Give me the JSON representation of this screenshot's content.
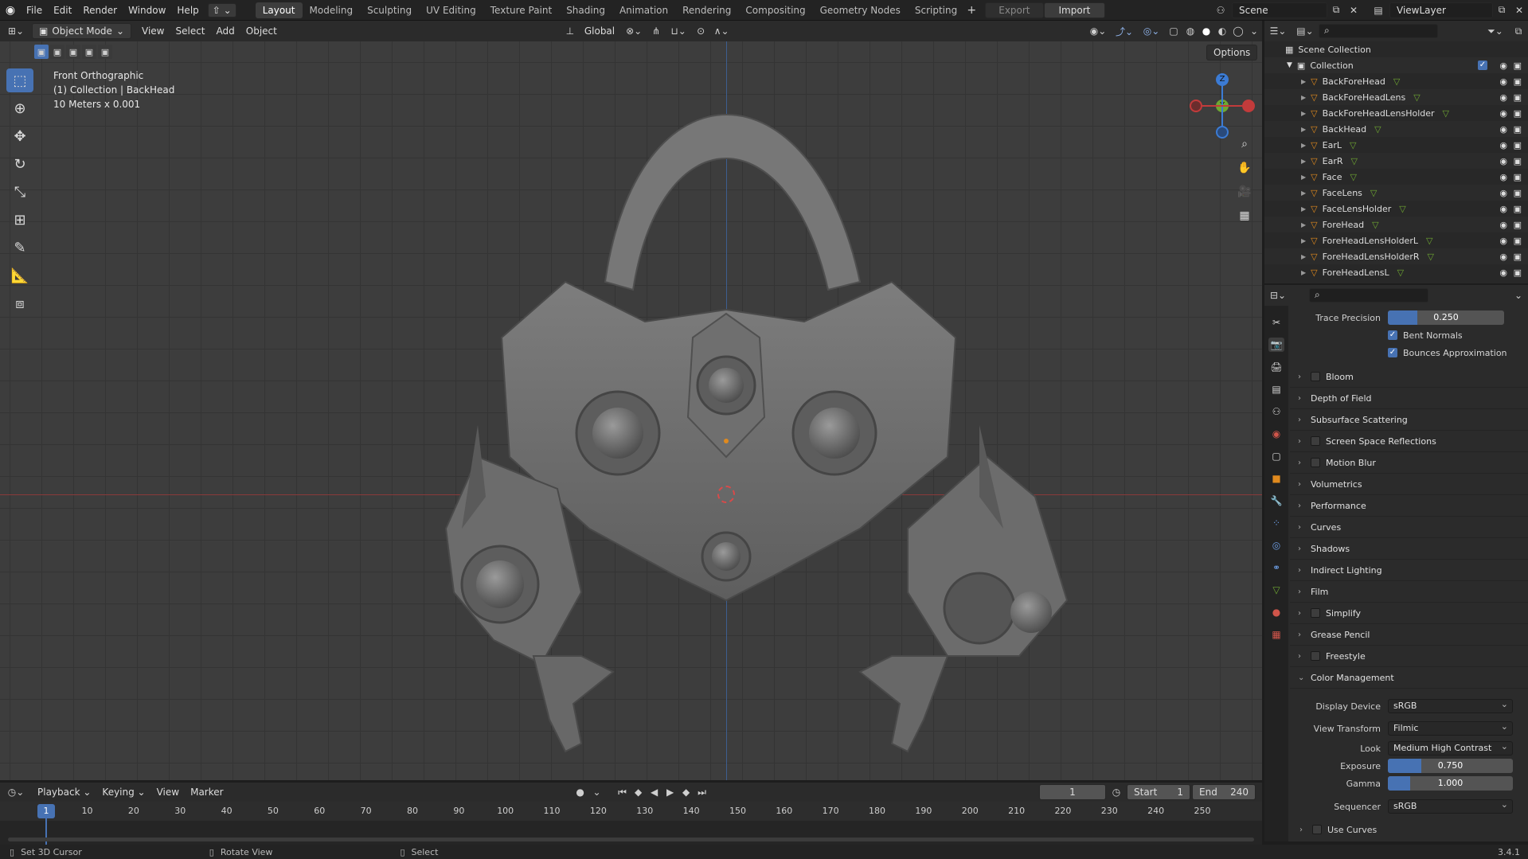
{
  "topbar": {
    "menus": [
      "File",
      "Edit",
      "Render",
      "Window",
      "Help"
    ],
    "workspaces": [
      "Layout",
      "Modeling",
      "Sculpting",
      "UV Editing",
      "Texture Paint",
      "Shading",
      "Animation",
      "Rendering",
      "Compositing",
      "Geometry Nodes",
      "Scripting"
    ],
    "active_workspace": "Layout",
    "export_label": "Export",
    "import_label": "Import",
    "scene_label": "Scene",
    "viewlayer_label": "ViewLayer"
  },
  "viewport_header": {
    "mode": "Object Mode",
    "menus": [
      "View",
      "Select",
      "Add",
      "Object"
    ],
    "orientation": "Global",
    "options_label": "Options"
  },
  "viewport": {
    "view_name": "Front Orthographic",
    "collection_info": "(1) Collection | BackHead",
    "scale_info": "10 Meters x 0.001",
    "axis_z": "Z",
    "axis_y": "Y"
  },
  "outliner": {
    "root": "Scene Collection",
    "collection": "Collection",
    "items": [
      "BackForeHead",
      "BackForeHeadLens",
      "BackForeHeadLensHolder",
      "BackHead",
      "EarL",
      "EarR",
      "Face",
      "FaceLens",
      "FaceLensHolder",
      "ForeHead",
      "ForeHeadLensHolderL",
      "ForeHeadLensHolderR",
      "ForeHeadLensL"
    ],
    "selected": "BackHead"
  },
  "properties": {
    "trace_precision": {
      "label": "Trace Precision",
      "value": "0.250",
      "fraction": 0.25
    },
    "bent_normals": "Bent Normals",
    "bounces_approximation": "Bounces Approximation",
    "sections": [
      {
        "label": "Bloom",
        "checkbox": true
      },
      {
        "label": "Depth of Field",
        "checkbox": false
      },
      {
        "label": "Subsurface Scattering",
        "checkbox": false
      },
      {
        "label": "Screen Space Reflections",
        "checkbox": true
      },
      {
        "label": "Motion Blur",
        "checkbox": true
      },
      {
        "label": "Volumetrics",
        "checkbox": false
      },
      {
        "label": "Performance",
        "checkbox": false
      },
      {
        "label": "Curves",
        "checkbox": false
      },
      {
        "label": "Shadows",
        "checkbox": false
      },
      {
        "label": "Indirect Lighting",
        "checkbox": false
      },
      {
        "label": "Film",
        "checkbox": false
      },
      {
        "label": "Simplify",
        "checkbox": true
      },
      {
        "label": "Grease Pencil",
        "checkbox": false
      },
      {
        "label": "Freestyle",
        "checkbox": true
      }
    ],
    "color_management": {
      "title": "Color Management",
      "display_device_label": "Display Device",
      "display_device": "sRGB",
      "view_transform_label": "View Transform",
      "view_transform": "Filmic",
      "look_label": "Look",
      "look": "Medium High Contrast",
      "exposure_label": "Exposure",
      "exposure": "0.750",
      "exposure_fraction": 0.27,
      "gamma_label": "Gamma",
      "gamma": "1.000",
      "gamma_fraction": 0.18,
      "sequencer_label": "Sequencer",
      "sequencer": "sRGB",
      "use_curves": "Use Curves"
    }
  },
  "timeline": {
    "menus": [
      "Playback",
      "Keying",
      "View",
      "Marker"
    ],
    "current_frame": "1",
    "start_label": "Start",
    "start": "1",
    "end_label": "End",
    "end": "240",
    "frames": [
      "1",
      "10",
      "20",
      "30",
      "40",
      "50",
      "60",
      "70",
      "80",
      "90",
      "100",
      "110",
      "120",
      "130",
      "140",
      "150",
      "160",
      "170",
      "180",
      "190",
      "200",
      "210",
      "220",
      "230",
      "240",
      "250"
    ]
  },
  "statusbar": {
    "hint1": "Set 3D Cursor",
    "hint2": "Rotate View",
    "hint3": "Select",
    "version": "3.4.1"
  },
  "colors": {
    "accent": "#4772b3",
    "x_axis": "#c23b3b",
    "y_axis": "#6fa832",
    "z_axis": "#3b7bd4"
  }
}
